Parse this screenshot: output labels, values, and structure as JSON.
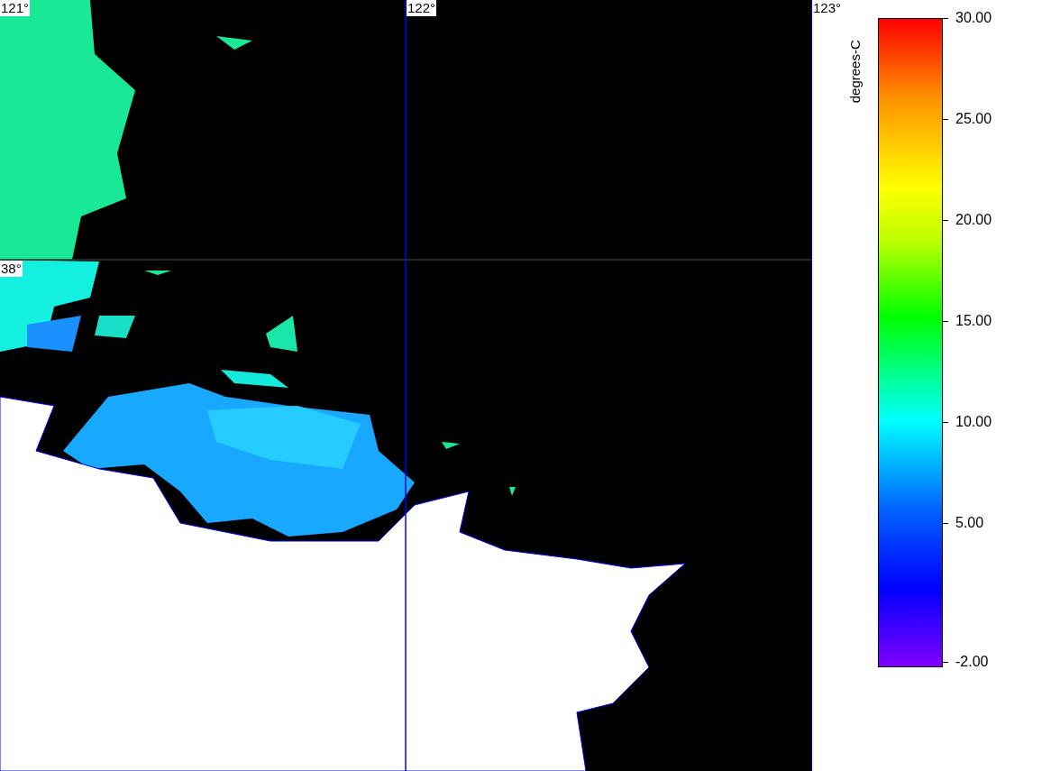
{
  "map": {
    "longitude_labels": [
      "121°",
      "122°",
      "123°"
    ],
    "latitude_labels": [
      "38°"
    ]
  },
  "colorbar": {
    "title": "degrees-C",
    "ticks": [
      "30.00",
      "25.00",
      "20.00",
      "15.00",
      "10.00",
      "5.00",
      "-2.00"
    ]
  }
}
